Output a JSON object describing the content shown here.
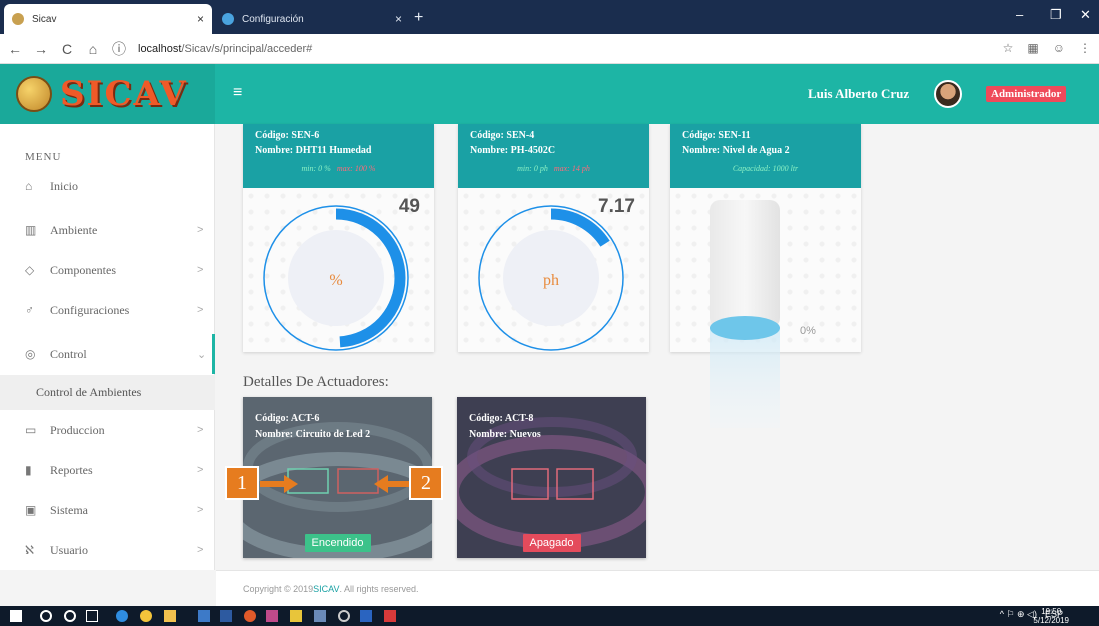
{
  "browser": {
    "tabs": [
      {
        "title": "Sicav",
        "close": "×"
      },
      {
        "title": "Configuración",
        "close": "×"
      }
    ],
    "new_tab": "+",
    "url_host": "localhost",
    "url_path": "/Sicav/s/principal/acceder#"
  },
  "header": {
    "logo": "SICAV",
    "menu_toggle": "≡",
    "user_name": "Luis Alberto Cruz",
    "role": "Administrador"
  },
  "sidebar": {
    "title": "MENU",
    "items": [
      {
        "label": "Inicio",
        "icon": "⌂"
      },
      {
        "label": "Ambiente",
        "icon": "▥"
      },
      {
        "label": "Componentes",
        "icon": "◇"
      },
      {
        "label": "Configuraciones",
        "icon": "♂"
      },
      {
        "label": "Control",
        "icon": "◎"
      },
      {
        "label": "Produccion",
        "icon": "▭"
      },
      {
        "label": "Reportes",
        "icon": "▮"
      },
      {
        "label": "Sistema",
        "icon": "▣"
      },
      {
        "label": "Usuario",
        "icon": "ℵ"
      }
    ],
    "sub_item": "Control de Ambientes"
  },
  "sensors": [
    {
      "code_label": "Código:",
      "code": "SEN-6",
      "name_label": "Nombre:",
      "name": "DHT11 Humedad",
      "min": "min: 0 %",
      "max": "max: 100 %",
      "value": "49",
      "unit": "%",
      "fraction": 0.49,
      "color": "#1e90e8"
    },
    {
      "code_label": "Código:",
      "code": "SEN-4",
      "name_label": "Nombre:",
      "name": "PH-4502C",
      "min": "min: 0 ph",
      "max": "max: 14 ph",
      "value": "7.17",
      "unit": "ph",
      "fraction": 0.16,
      "color": "#1e90e8"
    },
    {
      "code_label": "Código:",
      "code": "SEN-11",
      "name_label": "Nombre:",
      "name": "Nivel de Agua 2",
      "capacity": "Capacidad: 1000 ltr",
      "value": "0%",
      "fraction": 0.0,
      "color": "#6ec6ea"
    }
  ],
  "actuators_title": "Detalles De Actuadores:",
  "actuators": [
    {
      "code_label": "Código:",
      "code": "ACT-6",
      "name_label": "Nombre:",
      "name": "Circuito de Led 2",
      "status": "Encendido"
    },
    {
      "code_label": "Código:",
      "code": "ACT-8",
      "name_label": "Nombre:",
      "name": "Nuevos",
      "status": "Apagado"
    }
  ],
  "markers": [
    "1",
    "2"
  ],
  "footer": {
    "prefix": "Copyright © 2019 ",
    "brand": "SICAV",
    "suffix": ". All rights reserved."
  },
  "taskbar": {
    "lang": "ESP",
    "time": "19:50",
    "date": "5/12/2019"
  }
}
